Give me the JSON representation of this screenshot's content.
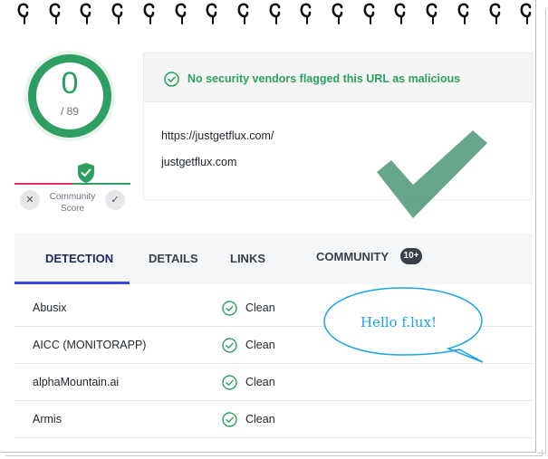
{
  "binding": {
    "ring_count": 17
  },
  "score": {
    "value": "0",
    "total": "/ 89",
    "color": "#2e9e63"
  },
  "community_score": {
    "label_line1": "Community",
    "label_line2": "Score",
    "down_icon": "close-icon",
    "up_icon": "check-icon"
  },
  "banner": {
    "text": "No security vendors flagged this URL as malicious",
    "icon": "check-circle-icon"
  },
  "url": {
    "full": "https://justgetflux.com/",
    "domain": "justgetflux.com"
  },
  "tabs": [
    {
      "label": "DETECTION",
      "active": true
    },
    {
      "label": "DETAILS"
    },
    {
      "label": "LINKS"
    },
    {
      "label": "COMMUNITY",
      "badge": "10+"
    }
  ],
  "detections": [
    {
      "vendor": "Abusix",
      "result": "Clean"
    },
    {
      "vendor": "AICC (MONITORAPP)",
      "result": "Clean"
    },
    {
      "vendor": "alphaMountain.ai",
      "result": "Clean"
    },
    {
      "vendor": "Armis",
      "result": "Clean"
    }
  ],
  "annotation": {
    "text": "Hello f.lux!",
    "color": "#1aa3e8",
    "check_color": "#5a9e82"
  },
  "colors": {
    "accent": "#3548e0",
    "clean": "#2e9e63",
    "malicious": "#e0355a"
  }
}
